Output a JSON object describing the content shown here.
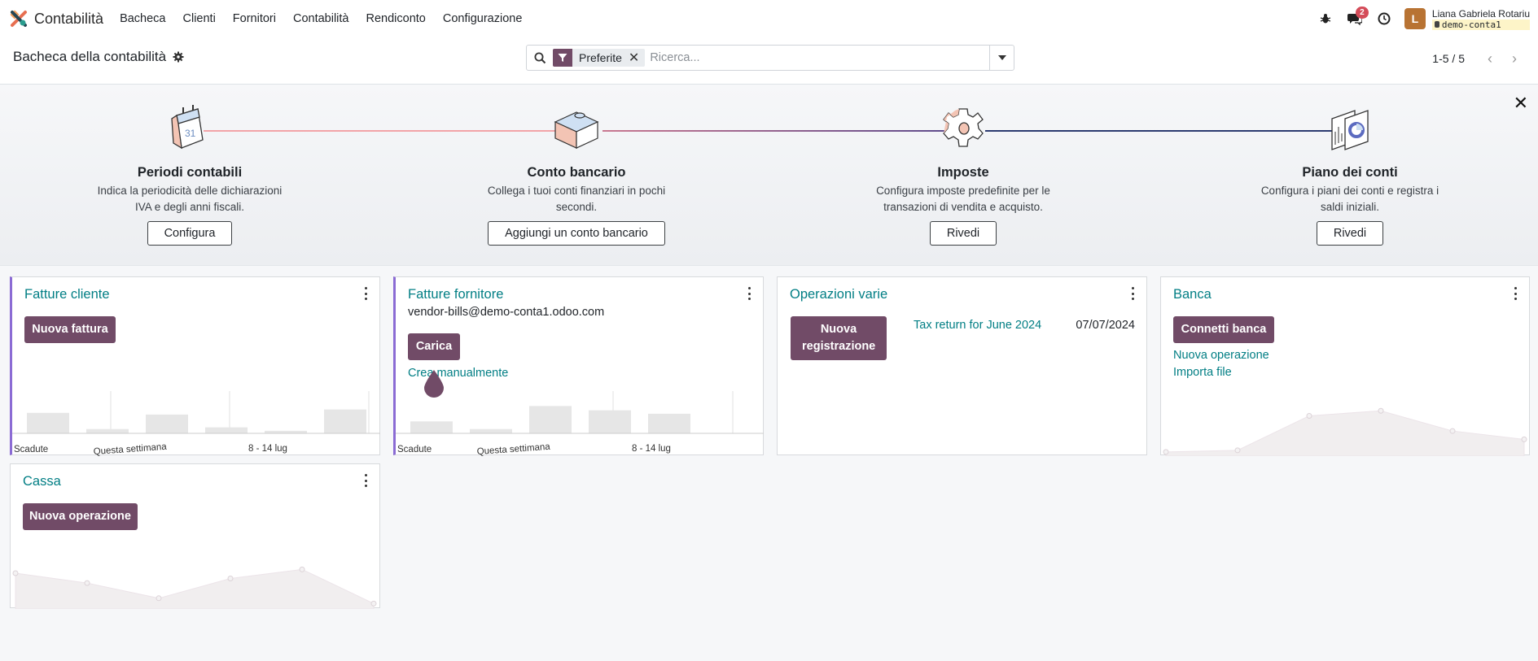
{
  "app": {
    "name": "Contabilità"
  },
  "menu": [
    "Bacheca",
    "Clienti",
    "Fornitori",
    "Contabilità",
    "Rendiconto",
    "Configurazione"
  ],
  "systray": {
    "bug_icon": "bug-icon",
    "chat_icon": "chat-icon",
    "chat_badge": "2",
    "activity_icon": "clock-icon"
  },
  "user": {
    "initial": "L",
    "name": "Liana Gabriela Rotariu",
    "db": "demo-conta1"
  },
  "control_panel": {
    "title": "Bacheca della contabilità",
    "search": {
      "facet": "Preferite",
      "placeholder": "Ricerca..."
    },
    "pager": "1-5 / 5"
  },
  "onboarding": {
    "steps": [
      {
        "title": "Periodi contabili",
        "desc": "Indica la periodicità delle dichiarazioni IVA e degli anni fiscali.",
        "button": "Configura",
        "icon": "calendar-icon"
      },
      {
        "title": "Conto bancario",
        "desc": "Collega i tuoi conti finanziari in pochi secondi.",
        "button": "Aggiungi un conto bancario",
        "icon": "puzzle-icon"
      },
      {
        "title": "Imposte",
        "desc": "Configura imposte predefinite per le transazioni di vendita e acquisto.",
        "button": "Rivedi",
        "icon": "gear-icon"
      },
      {
        "title": "Piano dei conti",
        "desc": "Configura i piani dei conti e registra i saldi iniziali.",
        "button": "Rivedi",
        "icon": "chart-of-accounts-icon"
      }
    ]
  },
  "cards": {
    "customer_invoices": {
      "title": "Fatture cliente",
      "button": "Nuova fattura",
      "chart_labels": [
        "Scadute",
        "Questa settimana",
        "8 - 14 lug"
      ]
    },
    "vendor_bills": {
      "title": "Fatture fornitore",
      "email": "vendor-bills@demo-conta1.odoo.com",
      "button": "Carica",
      "link": "Crea manualmente",
      "chart_labels": [
        "Scadute",
        "Questa settimana",
        "8 - 14 lug"
      ]
    },
    "misc_operations": {
      "title": "Operazioni varie",
      "button": "Nuova registrazione",
      "entry_label": "Tax return for June 2024",
      "entry_date": "07/07/2024"
    },
    "bank": {
      "title": "Banca",
      "button": "Connetti banca",
      "links": [
        "Nuova operazione",
        "Importa file"
      ]
    },
    "cash": {
      "title": "Cassa",
      "button": "Nuova operazione"
    }
  },
  "chart_data": [
    {
      "type": "bar",
      "name": "customer_invoices",
      "categories": [
        "1",
        "2",
        "3",
        "4",
        "5",
        "6"
      ],
      "values": [
        24,
        5,
        22,
        7,
        3,
        28
      ],
      "ylim": [
        0,
        40
      ]
    },
    {
      "type": "bar",
      "name": "vendor_bills",
      "categories": [
        "1",
        "2",
        "3",
        "4",
        "5",
        "6"
      ],
      "values": [
        14,
        5,
        32,
        27,
        23,
        0
      ],
      "ylim": [
        0,
        40
      ]
    },
    {
      "type": "area",
      "name": "bank",
      "values": [
        3,
        5,
        46,
        52,
        28,
        18
      ],
      "ylim": [
        0,
        60
      ]
    },
    {
      "type": "area",
      "name": "cash",
      "values": [
        45,
        32,
        12,
        38,
        50,
        5
      ],
      "ylim": [
        0,
        60
      ]
    }
  ]
}
